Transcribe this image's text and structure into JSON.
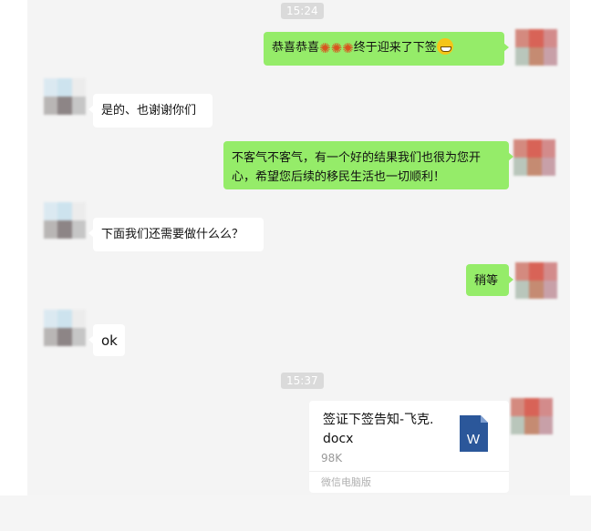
{
  "timestamps": [
    "15:24",
    "15:37"
  ],
  "messages": [
    {
      "side": "mine",
      "text": "恭喜恭喜",
      "text_after": "终于迎来了下签"
    },
    {
      "side": "theirs",
      "text": "是的、也谢谢你们"
    },
    {
      "side": "mine",
      "line1": "不客气不客气，有一个好的结果我们也很为您开",
      "line2": "心，希望您后续的移民生活也一切顺利！"
    },
    {
      "side": "theirs",
      "text": "下面我们还需要做什么么？"
    },
    {
      "side": "mine",
      "text": "稍等"
    },
    {
      "side": "theirs",
      "text": "ok"
    }
  ],
  "file": {
    "name_line1": "签证下签告知-飞克.",
    "name_line2": "docx",
    "size": "98K",
    "source": "微信电脑版",
    "icon": "word-file-icon",
    "icon_letter": "W",
    "icon_color": "#2b579a"
  },
  "emoji": {
    "firework": "firework-icon",
    "grin": "grinning-face-icon"
  },
  "colors": {
    "mine_bubble": "#95ec69",
    "theirs_bubble": "#ffffff",
    "timestamp_bg": "#dadada"
  }
}
